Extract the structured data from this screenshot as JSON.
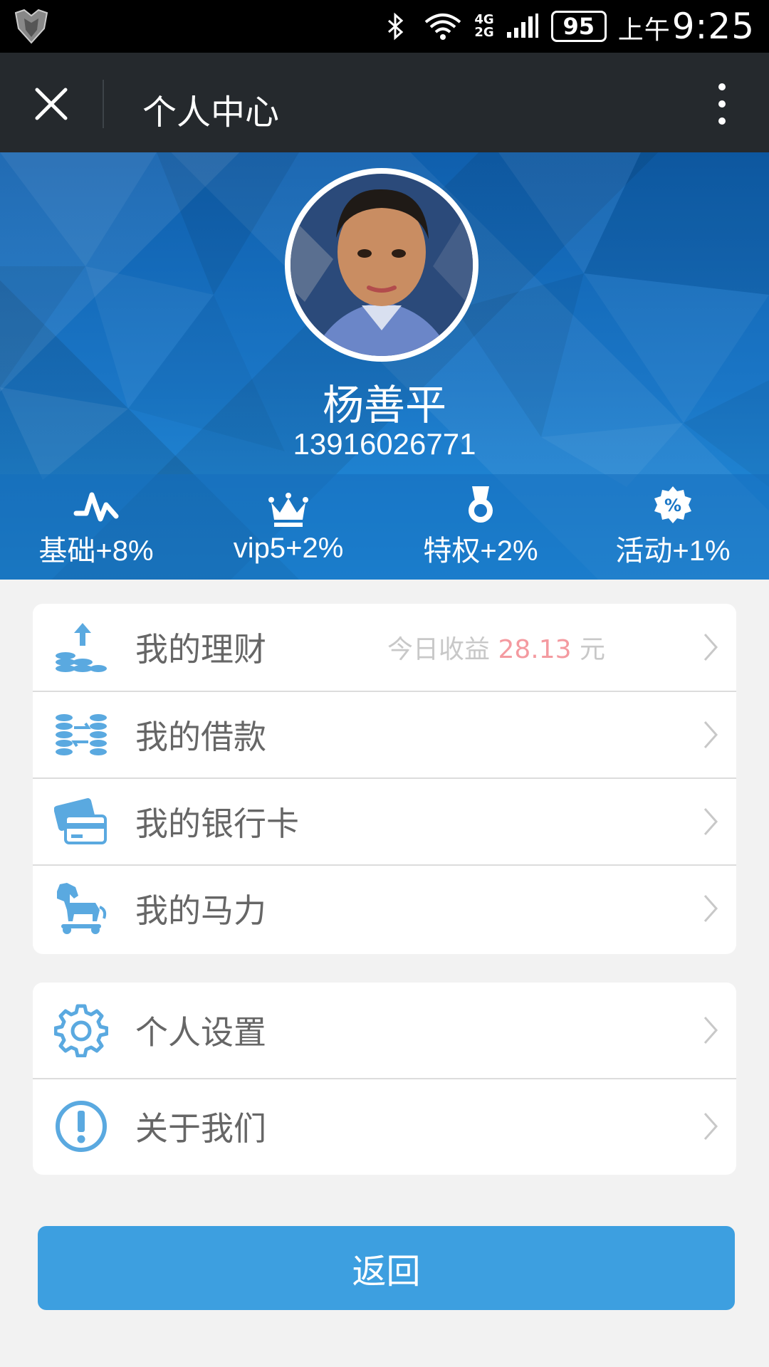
{
  "status_bar": {
    "network_top": "4G",
    "network_bottom": "2G",
    "battery": "95",
    "ampm": "上午",
    "time": "9:25"
  },
  "title_bar": {
    "title": "个人中心"
  },
  "profile": {
    "name": "杨善平",
    "phone": "13916026771",
    "stats": [
      {
        "icon": "pulse-icon",
        "label": "基础+8%"
      },
      {
        "icon": "crown-icon",
        "label": "vip5+2%"
      },
      {
        "icon": "medal-icon",
        "label": "特权+2%"
      },
      {
        "icon": "percent-badge-icon",
        "label": "活动+1%"
      }
    ]
  },
  "menu_primary": [
    {
      "icon": "coins-up-icon",
      "label": "我的理财",
      "earn_prefix": "今日收益",
      "earn_amount": "28.13",
      "earn_unit": "元"
    },
    {
      "icon": "coins-exchange-icon",
      "label": "我的借款"
    },
    {
      "icon": "bank-card-icon",
      "label": "我的银行卡"
    },
    {
      "icon": "horse-icon",
      "label": "我的马力"
    }
  ],
  "menu_secondary": [
    {
      "icon": "gear-icon",
      "label": "个人设置"
    },
    {
      "icon": "exclamation-circle-icon",
      "label": "关于我们"
    }
  ],
  "back_button": {
    "label": "返回"
  },
  "colors": {
    "accent": "#3d9fe0",
    "icon_blue": "#5aa9e0",
    "earn_amount": "#f49aa0",
    "title_bar": "#25292d"
  }
}
